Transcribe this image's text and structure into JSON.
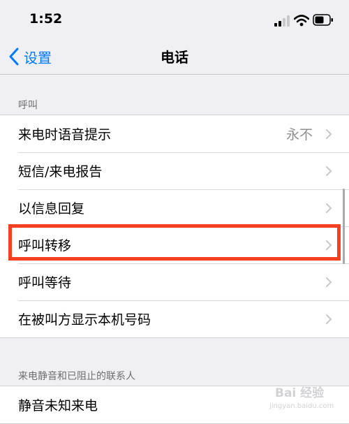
{
  "status_bar": {
    "time": "1:52"
  },
  "nav": {
    "back_label": "设置",
    "title": "电话"
  },
  "section_calls": {
    "header": "呼叫"
  },
  "calls_rows": [
    {
      "label": "来电时语音提示",
      "value": "永不"
    },
    {
      "label": "短信/来电报告"
    },
    {
      "label": "以信息回复"
    },
    {
      "label": "呼叫转移"
    },
    {
      "label": "呼叫等待"
    },
    {
      "label": "在被叫方显示本机号码"
    }
  ],
  "section_silence": {
    "header": "来电静音和已阻止的联系人"
  },
  "silence_rows": [
    {
      "label": "静音未知来电"
    }
  ],
  "watermark": {
    "text": "Bai 经验",
    "sub": "jingyan.baidu.com"
  },
  "colors": {
    "accent": "#007aff",
    "highlight": "#f4401e",
    "background": "#efeff4"
  },
  "icons": [
    "signal-icon",
    "wifi-icon",
    "battery-icon",
    "back-chevron-icon",
    "chevron-right-icon"
  ]
}
